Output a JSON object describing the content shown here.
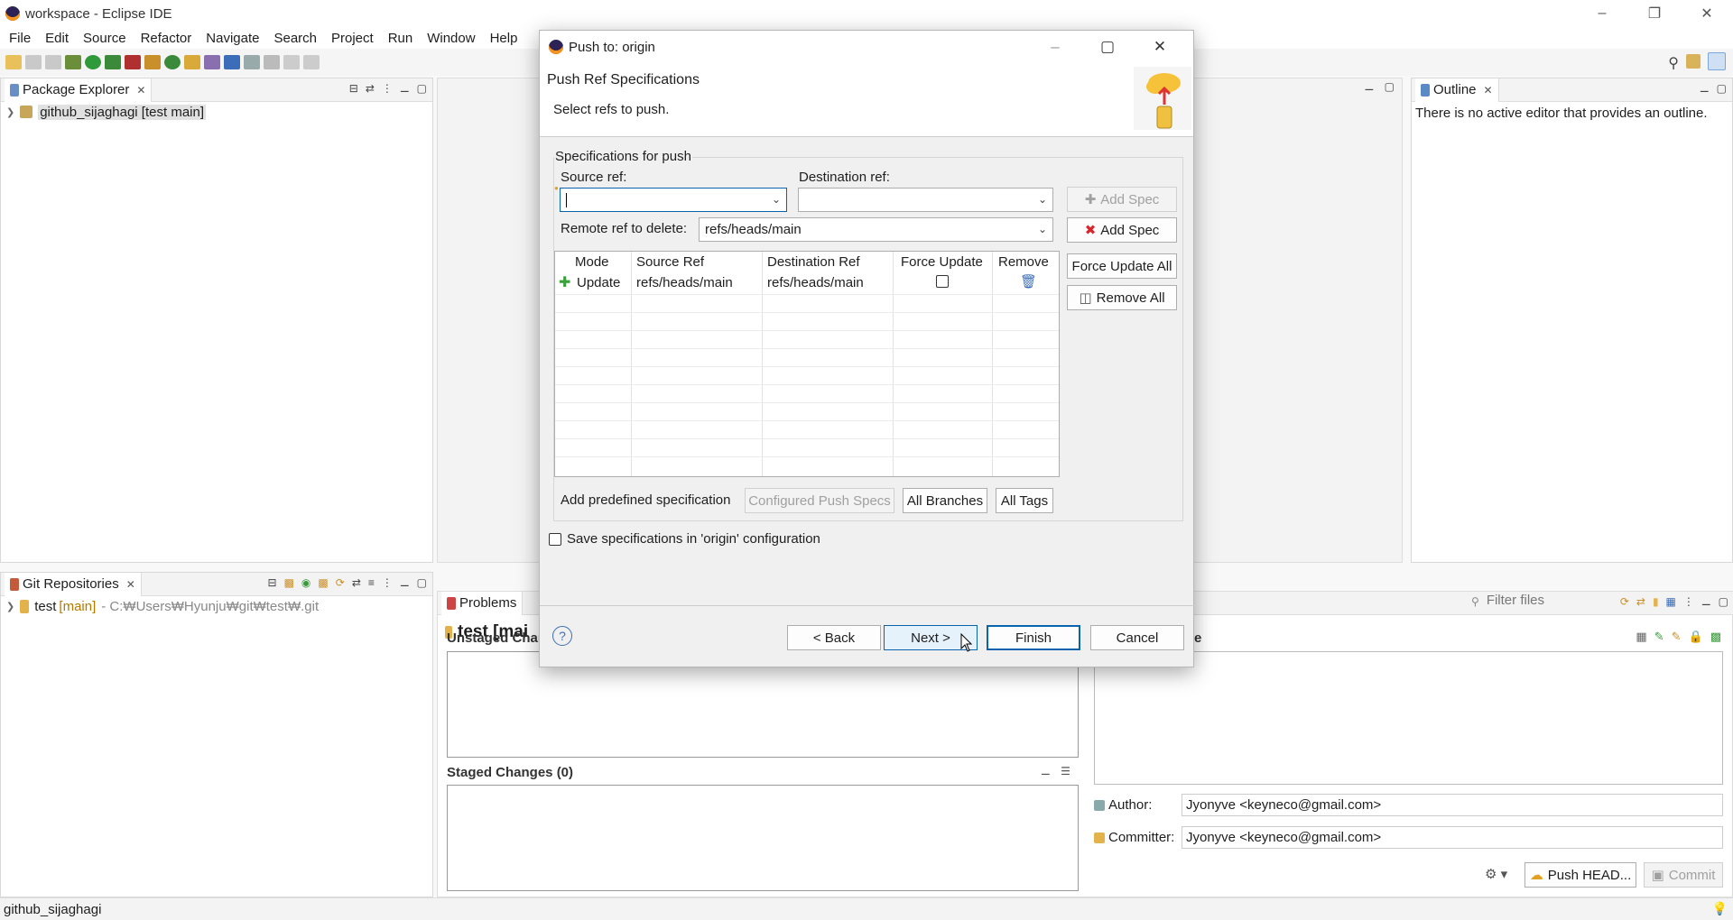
{
  "window": {
    "title": "workspace - Eclipse IDE",
    "controls": [
      "minimize-icon",
      "restore-icon",
      "close-icon"
    ]
  },
  "menu": [
    "File",
    "Edit",
    "Source",
    "Refactor",
    "Navigate",
    "Search",
    "Project",
    "Run",
    "Window",
    "Help"
  ],
  "package_explorer": {
    "tab": "Package Explorer",
    "project": "github_sijaghagi [test main]"
  },
  "git_repos": {
    "tab": "Git Repositories",
    "repo_name": "test",
    "repo_branch": "[main]",
    "repo_path": "- C:₩Users₩Hyunju₩git₩test₩.git"
  },
  "outline": {
    "tab": "Outline",
    "message": "There is no active editor that provides an outline."
  },
  "problems_tab": "Problems",
  "staging": {
    "title": "test [mai",
    "unstaged": "Unstaged Chan",
    "staged": "Staged Changes (0)",
    "filter_placeholder": "Filter files",
    "commit_msg_header": "e",
    "author_label": "Author:",
    "author_value": "Jyonyve <keyneco@gmail.com>",
    "committer_label": "Committer:",
    "committer_value": "Jyonyve <keyneco@gmail.com>",
    "push_head": "Push HEAD...",
    "commit": "Commit"
  },
  "status": {
    "text": "github_sijaghagi"
  },
  "dialog": {
    "title": "Push to: origin",
    "header": "Push Ref Specifications",
    "subheader": "Select refs to push.",
    "group_label": "Specifications for push",
    "source_ref_label": "Source ref:",
    "source_ref_value": "",
    "dest_ref_label": "Destination ref:",
    "dest_ref_value": "",
    "add_spec_disabled": "Add Spec",
    "remote_delete_label": "Remote ref to delete:",
    "remote_delete_value": "refs/heads/main",
    "add_spec_delete": "Add Spec",
    "force_update_all": "Force Update All",
    "remove_all": "Remove All",
    "table": {
      "headers": [
        "Mode",
        "Source Ref",
        "Destination Ref",
        "Force Update",
        "Remove"
      ],
      "rows": [
        {
          "mode": "Update",
          "source": "refs/heads/main",
          "destination": "refs/heads/main",
          "force": false
        }
      ]
    },
    "predefined_label": "Add predefined specification",
    "configured_push_specs": "Configured Push Specs",
    "all_branches": "All Branches",
    "all_tags": "All Tags",
    "save_spec_label": "Save specifications in 'origin' configuration",
    "save_spec_checked": false,
    "back": "< Back",
    "next": "Next >",
    "finish": "Finish",
    "cancel": "Cancel"
  },
  "colors": {
    "accent": "#0a64ad",
    "branch": "#b57900",
    "add_green": "#3aa13a",
    "delete_red": "#d9262c"
  }
}
